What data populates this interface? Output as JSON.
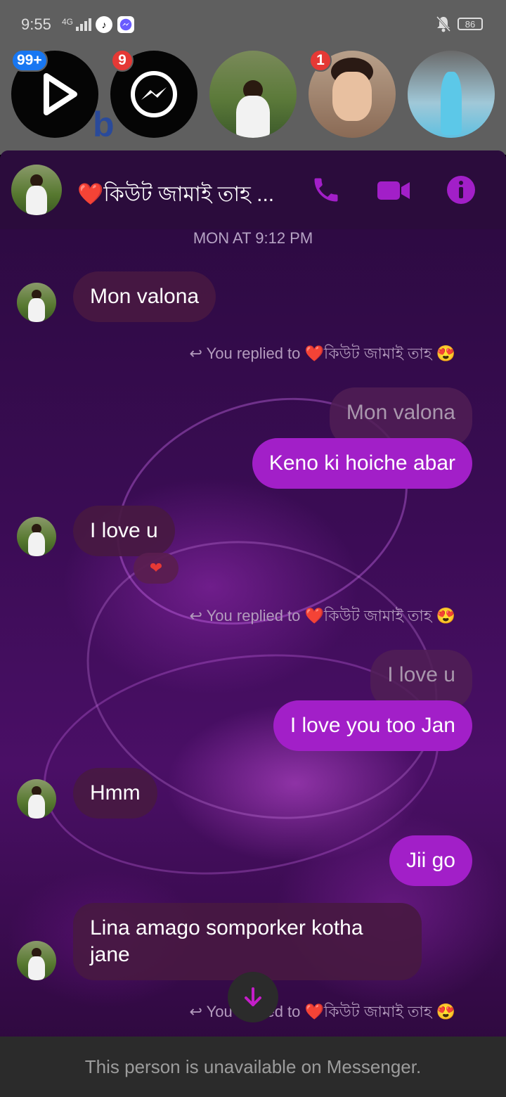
{
  "status_bar": {
    "time": "9:55",
    "signal": "4G",
    "battery": "86"
  },
  "chat_heads": {
    "badges": [
      "99+",
      "9",
      "1"
    ]
  },
  "header": {
    "title": "❤️কিউট জামাই তাহ ...",
    "icons": [
      "phone-icon",
      "video-camera-icon",
      "info-icon"
    ],
    "accent_color": "#a21fc8"
  },
  "conversation": {
    "timestamp": "MON AT 9:12 PM",
    "messages": [
      {
        "dir": "in",
        "text": "Mon valona"
      },
      {
        "dir": "meta",
        "text": "You replied to ❤️কিউট জামাই তাহ 😍"
      },
      {
        "dir": "quoted",
        "text": "Mon valona"
      },
      {
        "dir": "out",
        "text": "Keno ki hoiche abar"
      },
      {
        "dir": "in",
        "text": "I love u",
        "reaction": "❤"
      },
      {
        "dir": "meta",
        "text": "You replied to ❤️কিউট জামাই তাহ 😍"
      },
      {
        "dir": "quoted",
        "text": "I love u"
      },
      {
        "dir": "out",
        "text": "I love you too Jan"
      },
      {
        "dir": "in",
        "text": "Hmm"
      },
      {
        "dir": "out",
        "text": "Jii go"
      },
      {
        "dir": "in",
        "text": "Lina amago somporker kotha jane"
      },
      {
        "dir": "meta",
        "text": "You replied to ❤️কিউট জামাই তাহ 😍"
      }
    ]
  },
  "footer": {
    "text": "This person is unavailable on Messenger."
  }
}
